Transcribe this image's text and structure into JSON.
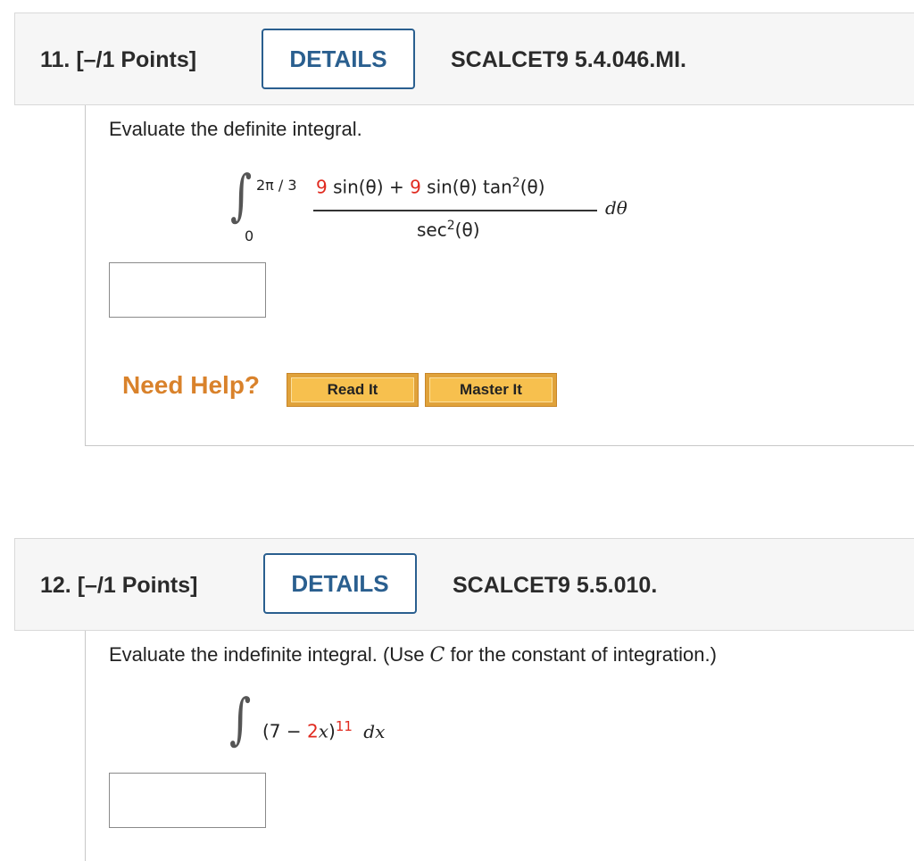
{
  "q11": {
    "number": "11.  [–/1 Points]",
    "details_label": "DETAILS",
    "code": "SCALCET9 5.4.046.MI.",
    "prompt": "Evaluate the definite integral.",
    "integral": {
      "upper_limit": "2π / 3",
      "lower_limit": "0",
      "num_coef1": "9",
      "num_term1": " sin(θ) + ",
      "num_coef2": "9",
      "num_term2": " sin(θ) tan",
      "num_exp": "2",
      "num_tail": "(θ)",
      "den_base": "sec",
      "den_exp": "2",
      "den_tail": "(θ)",
      "differential": "dθ"
    },
    "answer_value": "",
    "need_help_label": "Need Help?",
    "read_it_label": "Read It",
    "master_it_label": "Master It"
  },
  "q12": {
    "number": "12.  [–/1 Points]",
    "details_label": "DETAILS",
    "code": "SCALCET9 5.5.010.",
    "prompt_a": "Evaluate the indefinite integral. (Use ",
    "prompt_var": "C",
    "prompt_b": " for the constant of integration.)",
    "integral": {
      "open": "(7 − ",
      "red_term": "2",
      "var": "x",
      "close": ")",
      "exp": "11",
      "differential": "dx"
    },
    "answer_value": ""
  },
  "colors": {
    "accent_blue": "#2a5f8f",
    "coefficient_red": "#e02a1f",
    "help_orange": "#d9822b",
    "help_button_gold": "#f7c04e"
  }
}
